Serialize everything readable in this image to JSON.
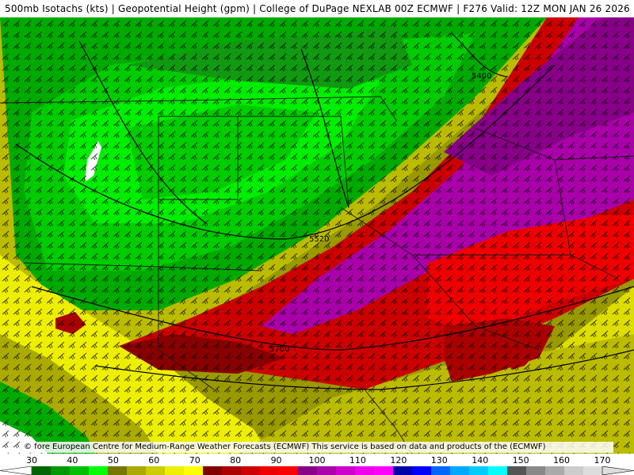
{
  "header": {
    "title": "500mb Isotachs (kts) | Geopotential Height (gpm) | College of DuPage NEXLAB   00Z ECMWF | F276 Valid: 12Z MON JAN 26 2026"
  },
  "attribution": {
    "text": "© fore European Centre for Medium-Range Weather Forecasts (ECMWF)  This service is based on data and products of the (ECMWF)"
  },
  "contour_labels": [
    "5400",
    "5520",
    "5700"
  ],
  "colorbar": {
    "labels": [
      "30",
      "40",
      "50",
      "60",
      "70",
      "80",
      "90",
      "100",
      "110",
      "120",
      "130",
      "140",
      "150",
      "160",
      "170"
    ],
    "colors": [
      "#006600",
      "#009900",
      "#00c000",
      "#00ff00",
      "#777700",
      "#aaaa00",
      "#cccc00",
      "#eeee00",
      "#ffff00",
      "#800000",
      "#aa0000",
      "#cc0000",
      "#ee0000",
      "#ff0000",
      "#880088",
      "#aa00aa",
      "#cc00cc",
      "#ee00ee",
      "#ff00ff",
      "#0000aa",
      "#0000ff",
      "#0066ff",
      "#00aaff",
      "#00ccff",
      "#00ffff",
      "#555555",
      "#888888",
      "#aaaaaa",
      "#cccccc",
      "#dddddd"
    ]
  }
}
